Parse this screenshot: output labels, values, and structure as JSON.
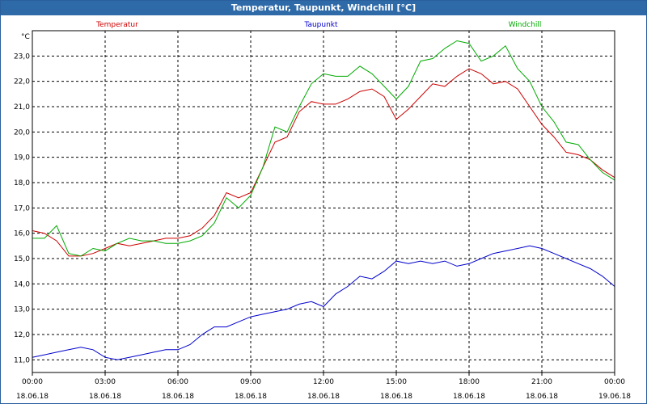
{
  "window": {
    "title": "Temperatur, Taupunkt, Windchill [°C]"
  },
  "chart_data": {
    "type": "line",
    "ylabel": "°C",
    "ylim": [
      10.5,
      24.0
    ],
    "xlim": [
      "18.06.18 00:00",
      "19.06.18 00:00"
    ],
    "yticks": [
      "11,0",
      "12,0",
      "13,0",
      "14,0",
      "15,0",
      "16,0",
      "17,0",
      "18,0",
      "19,0",
      "20,0",
      "21,0",
      "22,0",
      "23,0"
    ],
    "xticks": [
      {
        "time": "00:00",
        "date": "18.06.18"
      },
      {
        "time": "03:00",
        "date": "18.06.18"
      },
      {
        "time": "06:00",
        "date": "18.06.18"
      },
      {
        "time": "09:00",
        "date": "18.06.18"
      },
      {
        "time": "12:00",
        "date": "18.06.18"
      },
      {
        "time": "15:00",
        "date": "18.06.18"
      },
      {
        "time": "18:00",
        "date": "18.06.18"
      },
      {
        "time": "21:00",
        "date": "18.06.18"
      },
      {
        "time": "00:00",
        "date": "19.06.18"
      }
    ],
    "grid": true,
    "legend": "top",
    "x_hours": [
      0,
      0.5,
      1,
      1.5,
      2,
      2.5,
      3,
      3.5,
      4,
      4.5,
      5,
      5.5,
      6,
      6.5,
      7,
      7.5,
      8,
      8.5,
      9,
      9.5,
      10,
      10.5,
      11,
      11.5,
      12,
      12.5,
      13,
      13.5,
      14,
      14.5,
      15,
      15.5,
      16,
      16.5,
      17,
      17.5,
      18,
      18.5,
      19,
      19.5,
      20,
      20.5,
      21,
      21.5,
      22,
      22.5,
      23,
      23.5,
      24
    ],
    "series": [
      {
        "name": "Temperatur",
        "color": "#cc0000",
        "values": [
          16.1,
          16.0,
          15.7,
          15.1,
          15.1,
          15.2,
          15.4,
          15.6,
          15.5,
          15.6,
          15.7,
          15.8,
          15.8,
          15.9,
          16.2,
          16.7,
          17.6,
          17.4,
          17.6,
          18.6,
          19.6,
          19.8,
          20.8,
          21.2,
          21.1,
          21.1,
          21.3,
          21.6,
          21.7,
          21.4,
          20.5,
          20.9,
          21.4,
          21.9,
          21.8,
          22.2,
          22.5,
          22.3,
          21.9,
          22.0,
          21.7,
          21.0,
          20.3,
          19.8,
          19.2,
          19.1,
          18.9,
          18.5,
          18.2
        ]
      },
      {
        "name": "Taupunkt",
        "color": "#0000cc",
        "values": [
          11.1,
          11.2,
          11.3,
          11.4,
          11.5,
          11.4,
          11.1,
          11.0,
          11.1,
          11.2,
          11.3,
          11.4,
          11.4,
          11.6,
          12.0,
          12.3,
          12.3,
          12.5,
          12.7,
          12.8,
          12.9,
          13.0,
          13.2,
          13.3,
          13.1,
          13.6,
          13.9,
          14.3,
          14.2,
          14.5,
          14.9,
          14.8,
          14.9,
          14.8,
          14.9,
          14.7,
          14.8,
          15.0,
          15.2,
          15.3,
          15.4,
          15.5,
          15.4,
          15.2,
          15.0,
          14.8,
          14.6,
          14.3,
          13.9
        ]
      },
      {
        "name": "Windchill",
        "color": "#00aa00",
        "values": [
          15.8,
          15.8,
          16.3,
          15.2,
          15.1,
          15.4,
          15.3,
          15.6,
          15.8,
          15.7,
          15.7,
          15.6,
          15.6,
          15.7,
          15.9,
          16.4,
          17.4,
          17.0,
          17.5,
          18.6,
          20.2,
          20.0,
          21.0,
          21.9,
          22.3,
          22.2,
          22.2,
          22.6,
          22.3,
          21.8,
          21.3,
          21.8,
          22.8,
          22.9,
          23.3,
          23.6,
          23.5,
          22.8,
          23.0,
          23.4,
          22.5,
          22.0,
          21.0,
          20.4,
          19.6,
          19.5,
          18.9,
          18.4,
          18.1
        ]
      }
    ]
  }
}
